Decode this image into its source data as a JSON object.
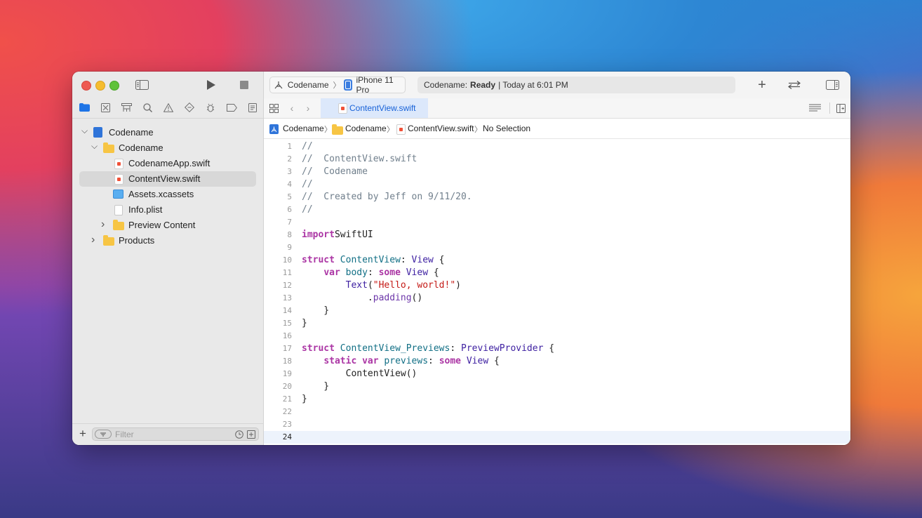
{
  "window": {
    "traffic_lights": [
      {
        "name": "close",
        "color": "#ee5a52"
      },
      {
        "name": "minimize",
        "color": "#f5bd30"
      },
      {
        "name": "zoom",
        "color": "#5fc23a"
      }
    ]
  },
  "toolbar": {
    "scheme": "Codename",
    "device": "iPhone 11 Pro",
    "status_project": "Codename:",
    "status_state": "Ready",
    "status_time": "| Today at 6:01 PM"
  },
  "navigator": {
    "tree": [
      {
        "label": "Codename",
        "kind": "project",
        "indent": 1,
        "expanded": true
      },
      {
        "label": "Codename",
        "kind": "folder",
        "indent": 2,
        "expanded": true
      },
      {
        "label": "CodenameApp.swift",
        "kind": "swift",
        "indent": 3
      },
      {
        "label": "ContentView.swift",
        "kind": "swift",
        "indent": 3,
        "selected": true
      },
      {
        "label": "Assets.xcassets",
        "kind": "assets",
        "indent": 3
      },
      {
        "label": "Info.plist",
        "kind": "plist",
        "indent": 3
      },
      {
        "label": "Preview Content",
        "kind": "folder",
        "indent": 3,
        "expanded": false
      },
      {
        "label": "Products",
        "kind": "folder",
        "indent": 2,
        "expanded": false
      }
    ],
    "filter_placeholder": "Filter"
  },
  "editor": {
    "tab_label": "ContentView.swift",
    "jump_bar": [
      "Codename",
      "Codename",
      "ContentView.swift",
      "No Selection"
    ],
    "current_line": 24,
    "lines": [
      [
        [
          "cm",
          "//"
        ]
      ],
      [
        [
          "cm",
          "//  ContentView.swift"
        ]
      ],
      [
        [
          "cm",
          "//  Codename"
        ]
      ],
      [
        [
          "cm",
          "//"
        ]
      ],
      [
        [
          "cm",
          "//  Created by Jeff on 9/11/20."
        ]
      ],
      [
        [
          "cm",
          "//"
        ]
      ],
      [],
      [
        [
          "kw",
          "import"
        ],
        [
          "",
          "SwiftUI"
        ]
      ],
      [],
      [
        [
          "kw",
          "struct"
        ],
        [
          "",
          " "
        ],
        [
          "tp",
          "ContentView"
        ],
        [
          "",
          ": "
        ],
        [
          "ty",
          "View"
        ],
        [
          "",
          " {"
        ]
      ],
      [
        [
          "",
          "    "
        ],
        [
          "kw",
          "var"
        ],
        [
          "",
          " "
        ],
        [
          "tp",
          "body"
        ],
        [
          "",
          ": "
        ],
        [
          "kw",
          "some"
        ],
        [
          "",
          " "
        ],
        [
          "ty",
          "View"
        ],
        [
          "",
          " {"
        ]
      ],
      [
        [
          "",
          "        "
        ],
        [
          "ty",
          "Text"
        ],
        [
          "",
          "("
        ],
        [
          "st",
          "\"Hello, world!\""
        ],
        [
          "",
          ")"
        ]
      ],
      [
        [
          "",
          "            ."
        ],
        [
          "fn",
          "padding"
        ],
        [
          "",
          "()"
        ]
      ],
      [
        [
          "",
          "    }"
        ]
      ],
      [
        [
          "",
          "}"
        ]
      ],
      [],
      [
        [
          "kw",
          "struct"
        ],
        [
          "",
          " "
        ],
        [
          "tp",
          "ContentView_Previews"
        ],
        [
          "",
          ": "
        ],
        [
          "ty",
          "PreviewProvider"
        ],
        [
          "",
          " {"
        ]
      ],
      [
        [
          "",
          "    "
        ],
        [
          "kw",
          "static"
        ],
        [
          "",
          " "
        ],
        [
          "kw",
          "var"
        ],
        [
          "",
          " "
        ],
        [
          "tp",
          "previews"
        ],
        [
          "",
          ": "
        ],
        [
          "kw",
          "some"
        ],
        [
          "",
          " "
        ],
        [
          "ty",
          "View"
        ],
        [
          "",
          " {"
        ]
      ],
      [
        [
          "",
          "        ContentView()"
        ]
      ],
      [
        [
          "",
          "    }"
        ]
      ],
      [
        [
          "",
          "}"
        ]
      ],
      [],
      [],
      []
    ]
  }
}
